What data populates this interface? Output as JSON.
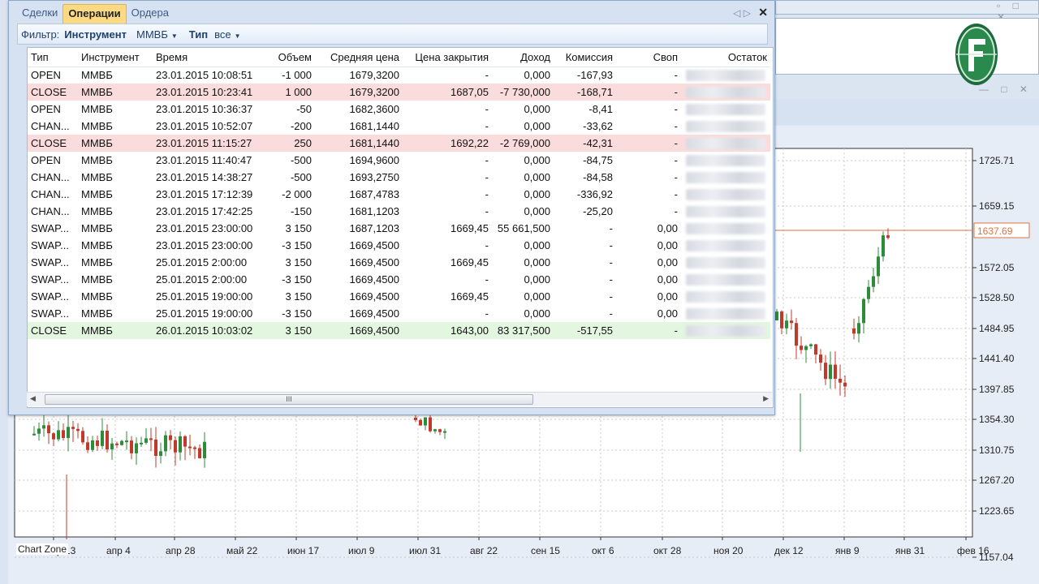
{
  "tabs": [
    "Сделки",
    "Операции",
    "Ордера"
  ],
  "filter": {
    "label": "Фильтр:",
    "instrument_label": "Инструмент",
    "instrument_value": "ММВБ",
    "type_label": "Тип",
    "type_value": "все"
  },
  "table": {
    "columns": [
      "Тип",
      "Инструмент",
      "Время",
      "Объем",
      "Средняя цена",
      "Цена закрытия",
      "Доход",
      "Комиссия",
      "Своп",
      "Остаток"
    ],
    "rows": [
      {
        "style": "",
        "cells": [
          "OPEN",
          "ММВБ",
          "23.01.2015 10:08:51",
          "-1 000",
          "1679,3200",
          "-",
          "0,000",
          "-167,93",
          "-"
        ]
      },
      {
        "style": "red",
        "cells": [
          "CLOSE",
          "ММВБ",
          "23.01.2015 10:23:41",
          "1 000",
          "1679,3200",
          "1687,05",
          "-7 730,000",
          "-168,71",
          "-"
        ]
      },
      {
        "style": "",
        "cells": [
          "OPEN",
          "ММВБ",
          "23.01.2015 10:36:37",
          "-50",
          "1682,3600",
          "-",
          "0,000",
          "-8,41",
          "-"
        ]
      },
      {
        "style": "",
        "cells": [
          "CHAN...",
          "ММВБ",
          "23.01.2015 10:52:07",
          "-200",
          "1681,1440",
          "-",
          "0,000",
          "-33,62",
          "-"
        ]
      },
      {
        "style": "red",
        "cells": [
          "CLOSE",
          "ММВБ",
          "23.01.2015 11:15:27",
          "250",
          "1681,1440",
          "1692,22",
          "-2 769,000",
          "-42,31",
          "-"
        ]
      },
      {
        "style": "",
        "cells": [
          "OPEN",
          "ММВБ",
          "23.01.2015 11:40:47",
          "-500",
          "1694,9600",
          "-",
          "0,000",
          "-84,75",
          "-"
        ]
      },
      {
        "style": "",
        "cells": [
          "CHAN...",
          "ММВБ",
          "23.01.2015 14:38:27",
          "-500",
          "1693,2750",
          "-",
          "0,000",
          "-84,58",
          "-"
        ]
      },
      {
        "style": "",
        "cells": [
          "CHAN...",
          "ММВБ",
          "23.01.2015 17:12:39",
          "-2 000",
          "1687,4783",
          "-",
          "0,000",
          "-336,92",
          "-"
        ]
      },
      {
        "style": "",
        "cells": [
          "CHAN...",
          "ММВБ",
          "23.01.2015 17:42:25",
          "-150",
          "1681,1203",
          "-",
          "0,000",
          "-25,20",
          "-"
        ]
      },
      {
        "style": "",
        "cells": [
          "SWAP...",
          "ММВБ",
          "23.01.2015 23:00:00",
          "3 150",
          "1687,1203",
          "1669,45",
          "55 661,500",
          "-",
          "0,00"
        ]
      },
      {
        "style": "",
        "cells": [
          "SWAP...",
          "ММВБ",
          "23.01.2015 23:00:00",
          "-3 150",
          "1669,4500",
          "-",
          "0,000",
          "-",
          "0,00"
        ]
      },
      {
        "style": "",
        "cells": [
          "SWAP...",
          "ММВБ",
          "25.01.2015 2:00:00",
          "3 150",
          "1669,4500",
          "1669,45",
          "0,000",
          "-",
          "0,00"
        ]
      },
      {
        "style": "",
        "cells": [
          "SWAP...",
          "ММВБ",
          "25.01.2015 2:00:00",
          "-3 150",
          "1669,4500",
          "-",
          "0,000",
          "-",
          "0,00"
        ]
      },
      {
        "style": "",
        "cells": [
          "SWAP...",
          "ММВБ",
          "25.01.2015 19:00:00",
          "3 150",
          "1669,4500",
          "1669,45",
          "0,000",
          "-",
          "0,00"
        ]
      },
      {
        "style": "",
        "cells": [
          "SWAP...",
          "ММВБ",
          "25.01.2015 19:00:00",
          "-3 150",
          "1669,4500",
          "-",
          "0,000",
          "-",
          "0,00"
        ]
      },
      {
        "style": "green",
        "cells": [
          "CLOSE",
          "ММВБ",
          "26.01.2015 10:03:02",
          "3 150",
          "1669,4500",
          "1643,00",
          "83 317,500",
          "-517,55",
          "-"
        ]
      }
    ]
  },
  "chart": {
    "label": "Chart Zone",
    "current_price": "1637.69",
    "y_ticks": [
      "1725.71",
      "1659.15",
      "1572.05",
      "1528.50",
      "1484.95",
      "1441.40",
      "1397.85",
      "1354.30",
      "1310.75",
      "1267.20",
      "1223.65",
      "1157.04"
    ],
    "x_ticks": [
      "мар 13",
      "апр 4",
      "апр 28",
      "май 22",
      "июн 17",
      "июл 9",
      "июл 31",
      "авг 22",
      "сен 15",
      "окт 6",
      "окт 28",
      "ноя 20",
      "дек 12",
      "янв 9",
      "янв 31",
      "фев 16"
    ],
    "colors": {
      "up": "#2e8b3a",
      "down": "#c0392b",
      "price_line": "#e07040"
    }
  }
}
